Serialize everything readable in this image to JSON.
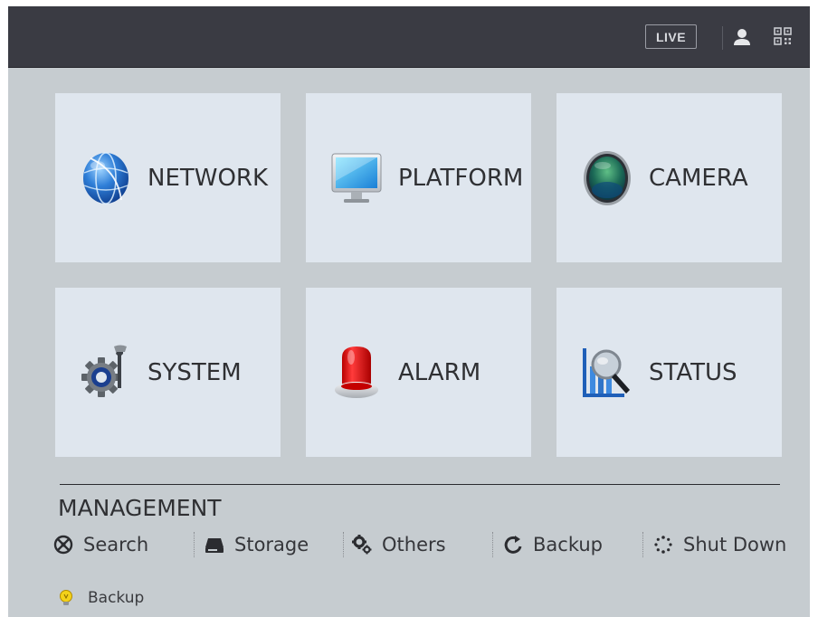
{
  "topbar": {
    "live_label": "LIVE",
    "icons": [
      "user-icon",
      "qr-code-icon"
    ]
  },
  "tiles": [
    {
      "label": "NETWORK",
      "icon": "globe-icon"
    },
    {
      "label": "PLATFORM",
      "icon": "monitor-icon"
    },
    {
      "label": "CAMERA",
      "icon": "camera-lens-icon"
    },
    {
      "label": "SYSTEM",
      "icon": "gear-wrench-icon"
    },
    {
      "label": "ALARM",
      "icon": "alarm-siren-icon"
    },
    {
      "label": "STATUS",
      "icon": "status-chart-magnifier-icon"
    }
  ],
  "management": {
    "title": "MANAGEMENT",
    "items": [
      {
        "label": "Search",
        "icon": "search-reel-icon"
      },
      {
        "label": "Storage",
        "icon": "hard-drive-icon"
      },
      {
        "label": "Others",
        "icon": "gears-icon"
      },
      {
        "label": "Backup",
        "icon": "refresh-icon"
      },
      {
        "label": "Shut Down",
        "icon": "spinner-icon"
      }
    ]
  },
  "tip": {
    "label": "Backup",
    "icon": "lightbulb-icon"
  },
  "colors": {
    "topbar": "#3a3b43",
    "background": "#c6ccd0",
    "tile": "#dfe6ee",
    "text": "#2f3033"
  }
}
